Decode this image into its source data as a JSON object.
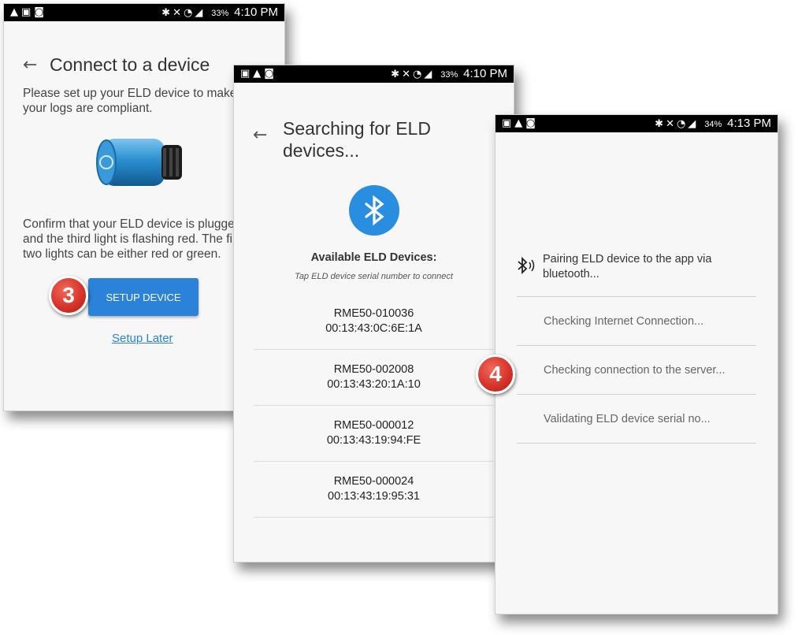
{
  "screen1": {
    "status": {
      "battery": "33%",
      "time": "4:10 PM"
    },
    "title": "Connect to a device",
    "intro": "Please set up your ELD device to make\nyour logs are compliant.",
    "instructions": "Confirm that your ELD device is plugge\nand the third light is flashing red. The fi\ntwo lights can be either red or green.",
    "setup_button": "SETUP DEVICE",
    "setup_later_link": "Setup Later",
    "step_badge": "3"
  },
  "screen2": {
    "status": {
      "battery": "33%",
      "time": "4:10 PM"
    },
    "title": "Searching for ELD\ndevices...",
    "available_heading": "Available ELD Devices:",
    "hint": "Tap ELD device serial number to connect",
    "devices": [
      {
        "serial": "RME50-010036",
        "mac": "00:13:43:0C:6E:1A"
      },
      {
        "serial": "RME50-002008",
        "mac": "00:13:43:20:1A:10"
      },
      {
        "serial": "RME50-000012",
        "mac": "00:13:43:19:94:FE"
      },
      {
        "serial": "RME50-000024",
        "mac": "00:13:43:19:95:31"
      }
    ]
  },
  "screen3": {
    "status": {
      "battery": "34%",
      "time": "4:13 PM"
    },
    "pairing": "Pairing ELD device to the app via\nbluetooth...",
    "checks": [
      "Checking Internet Connection...",
      "Checking connection to the server...",
      "Validating ELD device serial no..."
    ],
    "step_badge": "4"
  },
  "icons": {
    "back": "arrow-left-icon",
    "bluetooth": "bluetooth-icon",
    "bluetooth_connecting": "bluetooth-connecting-icon"
  },
  "colors": {
    "accent": "#2b82d9",
    "bluetooth_circle": "#2a8ee0",
    "badge_red": "#d8342a",
    "link": "#2a84d1"
  }
}
